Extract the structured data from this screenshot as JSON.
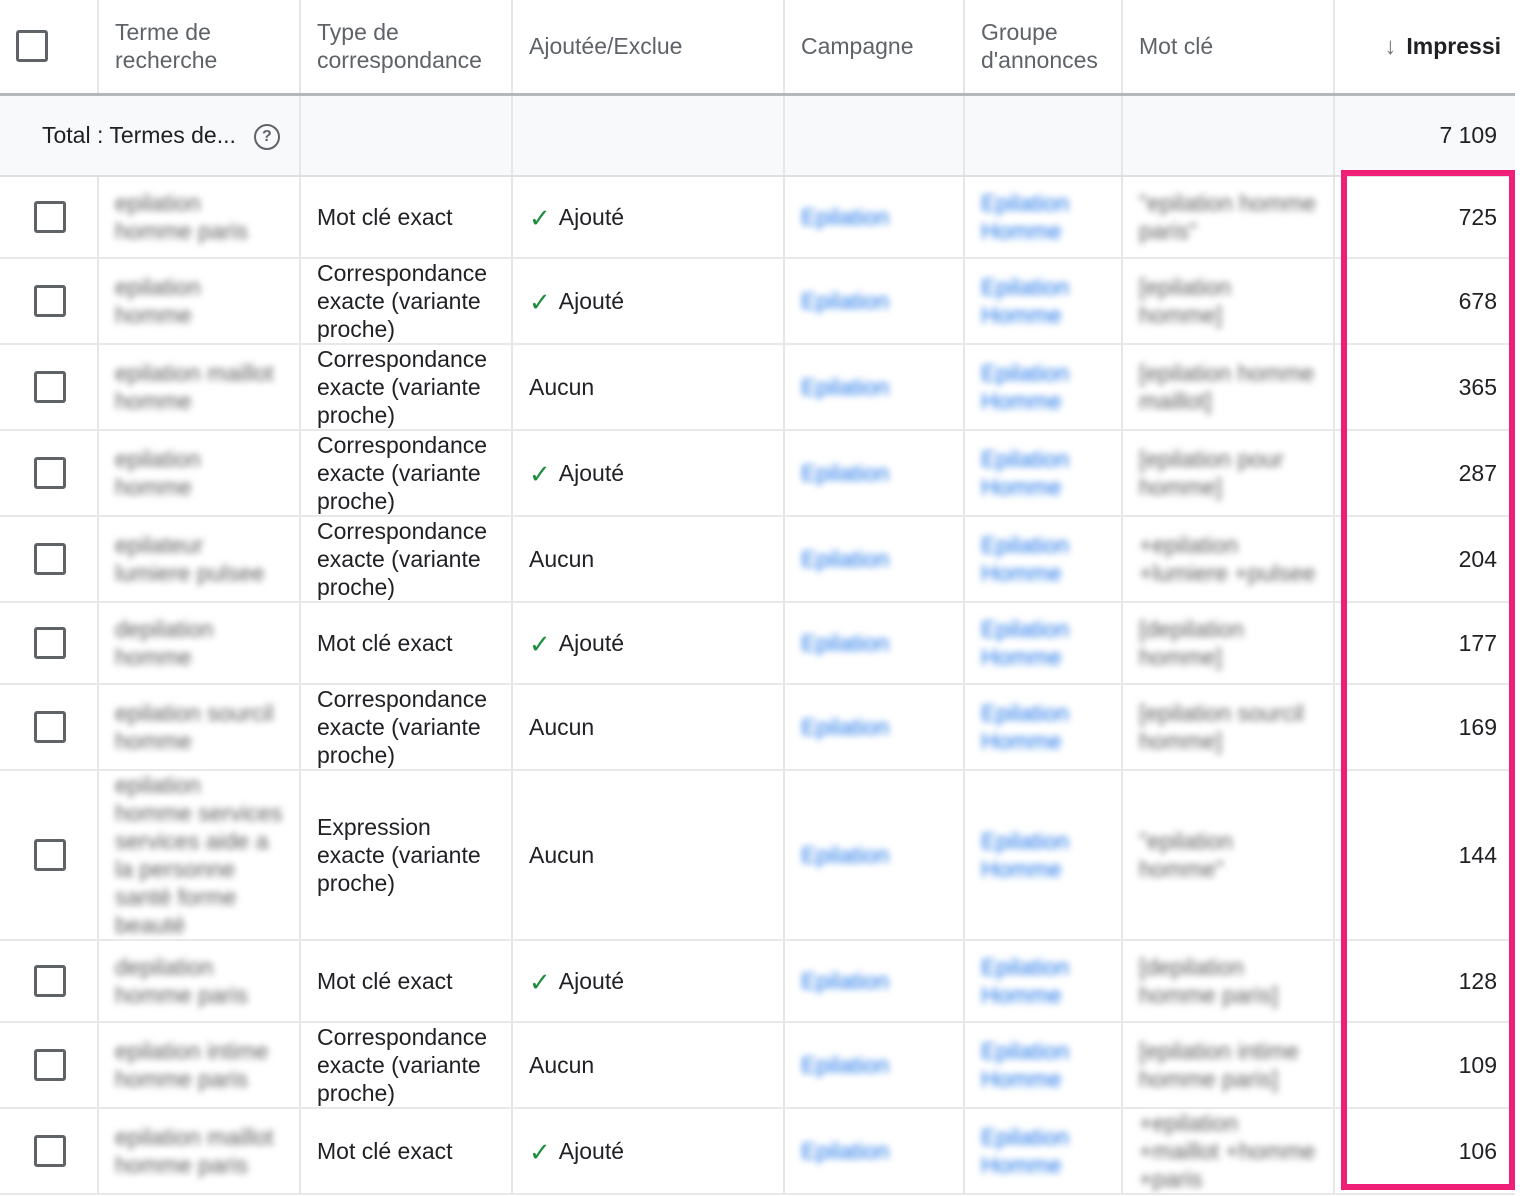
{
  "columns": {
    "search_term": "Terme de recherche",
    "match_type": "Type de correspondance",
    "added_excluded": "Ajoutée/Exclue",
    "campaign": "Campagne",
    "ad_group": "Groupe d'annonces",
    "keyword": "Mot clé",
    "impressions": "Impressi",
    "impressions_sort": "↓"
  },
  "total": {
    "label": "Total : Termes de...",
    "impressions": "7 109"
  },
  "colors": {
    "highlight": "#ef1f78",
    "link": "#1a73e8",
    "check": "#1e8e3e"
  },
  "rows": [
    {
      "term": "epilation homme paris",
      "match": "Mot clé exact",
      "status": "Ajouté",
      "added": true,
      "campaign": "Epilation",
      "adgroup": "Epilation Homme",
      "keyword": "\"epilation homme paris\"",
      "impressions": "725"
    },
    {
      "term": "epilation homme",
      "match": "Correspondance exacte (variante proche)",
      "status": "Ajouté",
      "added": true,
      "campaign": "Epilation",
      "adgroup": "Epilation Homme",
      "keyword": "[epilation homme]",
      "impressions": "678"
    },
    {
      "term": "epilation maillot homme",
      "match": "Correspondance exacte (variante proche)",
      "status": "Aucun",
      "added": false,
      "campaign": "Epilation",
      "adgroup": "Epilation Homme",
      "keyword": "[epilation homme maillot]",
      "impressions": "365"
    },
    {
      "term": "epilation homme",
      "match": "Correspondance exacte (variante proche)",
      "status": "Ajouté",
      "added": true,
      "campaign": "Epilation",
      "adgroup": "Epilation Homme",
      "keyword": "[epilation pour homme]",
      "impressions": "287"
    },
    {
      "term": "epilateur lumiere pulsee",
      "match": "Correspondance exacte (variante proche)",
      "status": "Aucun",
      "added": false,
      "campaign": "Epilation",
      "adgroup": "Epilation Homme",
      "keyword": "+epilation +lumiere +pulsee",
      "impressions": "204"
    },
    {
      "term": "depilation homme",
      "match": "Mot clé exact",
      "status": "Ajouté",
      "added": true,
      "campaign": "Epilation",
      "adgroup": "Epilation Homme",
      "keyword": "[depilation homme]",
      "impressions": "177"
    },
    {
      "term": "epilation sourcil homme",
      "match": "Correspondance exacte (variante proche)",
      "status": "Aucun",
      "added": false,
      "campaign": "Epilation",
      "adgroup": "Epilation Homme",
      "keyword": "[epilation sourcil homme]",
      "impressions": "169"
    },
    {
      "term": "epilation homme services services aide a la personne santé forme beauté",
      "match": "Expression exacte (variante proche)",
      "status": "Aucun",
      "added": false,
      "campaign": "Epilation",
      "adgroup": "Epilation Homme",
      "keyword": "\"epilation homme\"",
      "impressions": "144"
    },
    {
      "term": "depilation homme paris",
      "match": "Mot clé exact",
      "status": "Ajouté",
      "added": true,
      "campaign": "Epilation",
      "adgroup": "Epilation Homme",
      "keyword": "[depilation homme paris]",
      "impressions": "128"
    },
    {
      "term": "epilation intime homme paris",
      "match": "Correspondance exacte (variante proche)",
      "status": "Aucun",
      "added": false,
      "campaign": "Epilation",
      "adgroup": "Epilation Homme",
      "keyword": "[epilation intime homme paris]",
      "impressions": "109"
    },
    {
      "term": "epilation maillot homme paris",
      "match": "Mot clé exact",
      "status": "Ajouté",
      "added": true,
      "campaign": "Epilation",
      "adgroup": "Epilation Homme",
      "keyword": "+epilation +maillot +homme +paris",
      "impressions": "106"
    }
  ]
}
